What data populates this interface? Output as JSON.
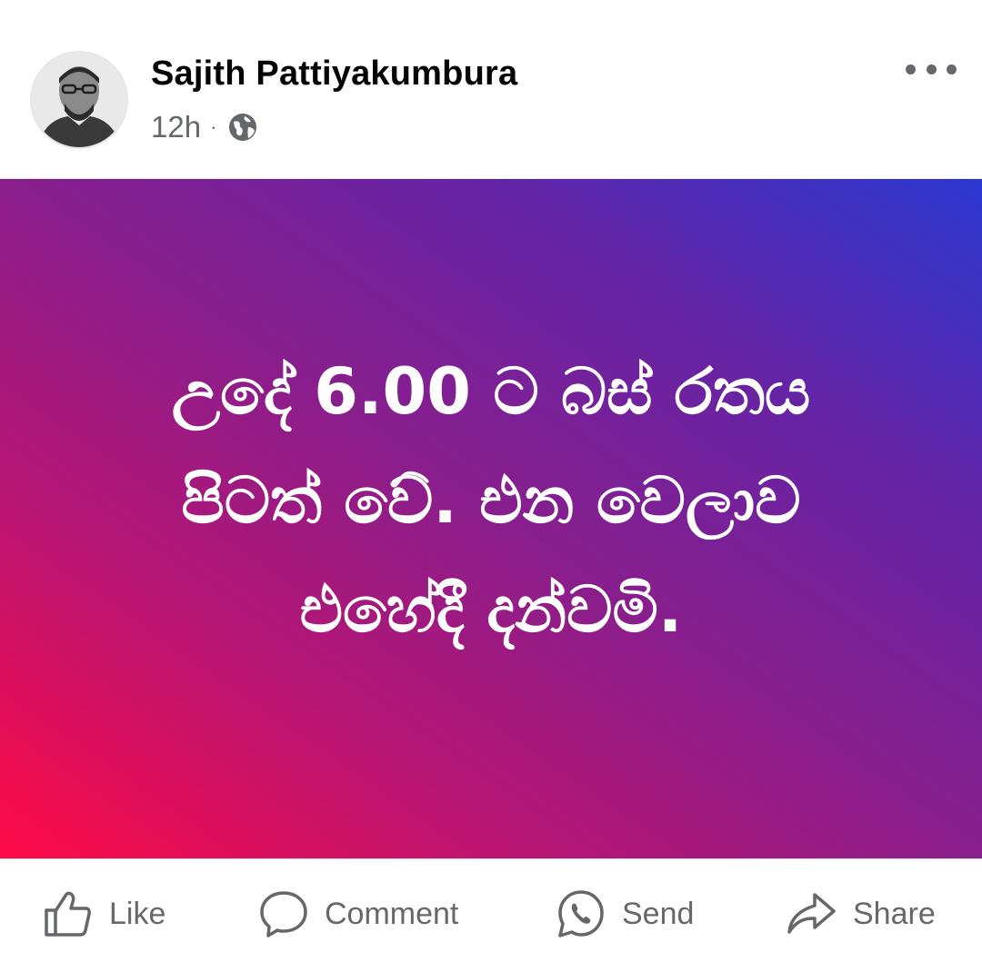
{
  "post": {
    "author": "Sajith Pattiyakumbura",
    "timestamp": "12h",
    "separator": "·",
    "audience_icon": "globe-icon",
    "status_text": "උදේ 6.00 ට බස් රතය\nපිටත් වේ. එන වෙලාව\nඑහේදී දන්වමි.",
    "background_gradient": [
      "#ff0a45",
      "#8a1e8c",
      "#2b38d1"
    ]
  },
  "actions": {
    "like": "Like",
    "comment": "Comment",
    "send": "Send",
    "share": "Share"
  },
  "colors": {
    "text_primary": "#050505",
    "text_secondary": "#65676b"
  }
}
